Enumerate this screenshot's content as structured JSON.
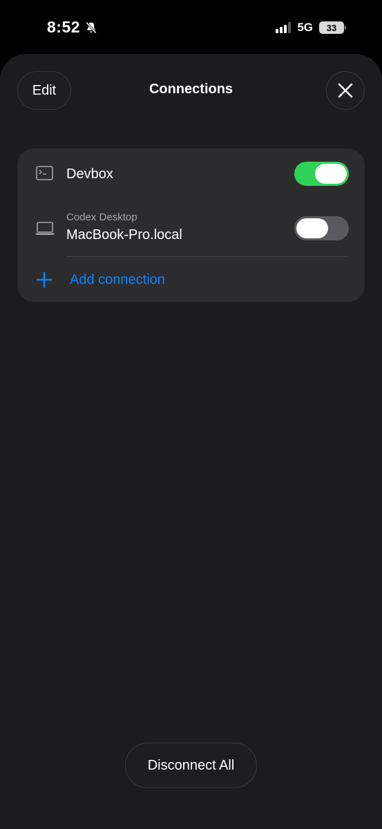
{
  "status_bar": {
    "time": "8:52",
    "network": "5G",
    "battery": "33",
    "icons": [
      "bell-slash-icon",
      "signal-icon",
      "battery-icon"
    ]
  },
  "header": {
    "edit_label": "Edit",
    "title": "Connections",
    "close_icon": "close-icon"
  },
  "connections": {
    "items": [
      {
        "title": "Devbox",
        "subtitle": "",
        "icon": "terminal-icon",
        "enabled": true
      },
      {
        "title": "MacBook-Pro.local",
        "subtitle": "Codex Desktop",
        "icon": "laptop-icon",
        "enabled": false
      }
    ],
    "add_label": "Add connection",
    "add_icon": "plus-icon"
  },
  "footer": {
    "disconnect_label": "Disconnect All"
  },
  "colors": {
    "sheet_bg": "#1c1c1e",
    "card_bg": "#2c2c2e",
    "toggle_on": "#30d158",
    "toggle_off": "#5a5a5e",
    "accent": "#0a84ff"
  }
}
